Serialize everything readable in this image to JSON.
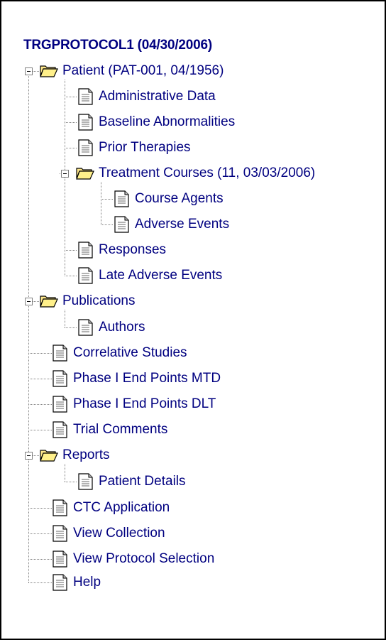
{
  "tree": {
    "title": "TRGPROTOCOL1 (04/30/2006)",
    "nodes": {
      "patient": "Patient (PAT-001, 04/1956)",
      "administrative_data": "Administrative Data",
      "baseline_abnormalities": "Baseline Abnormalities",
      "prior_therapies": "Prior Therapies",
      "treatment_courses": "Treatment Courses (11, 03/03/2006)",
      "course_agents": "Course Agents",
      "adverse_events": "Adverse Events",
      "responses": "Responses",
      "late_adverse_events": "Late Adverse Events",
      "publications": "Publications",
      "authors": "Authors",
      "correlative_studies": "Correlative Studies",
      "phase1_mtd": "Phase I End Points MTD",
      "phase1_dlt": "Phase I End Points DLT",
      "trial_comments": "Trial Comments",
      "reports": "Reports",
      "patient_details": "Patient Details",
      "ctc_application": "CTC Application",
      "view_collection": "View Collection",
      "view_protocol_selection": "View Protocol Selection",
      "help": "Help"
    }
  }
}
